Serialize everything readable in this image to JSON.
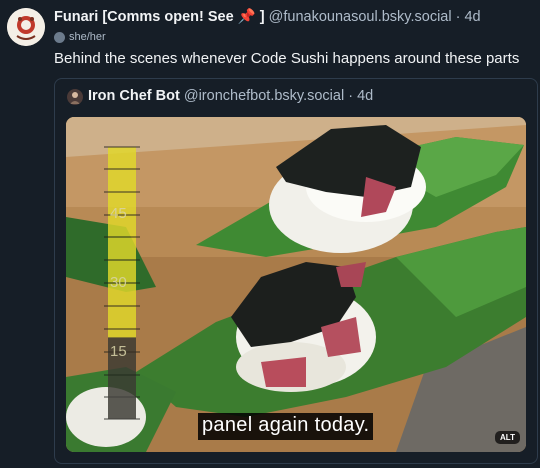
{
  "post": {
    "author": "Funari [Comms open! See ",
    "author_suffix": "]",
    "pin_icon": "pushpin-icon",
    "handle": "@funakounasoul.bsky.social",
    "separator": " · ",
    "time": "4d",
    "pronouns": "she/her",
    "text": "Behind the scenes whenever Code Sushi happens around these parts"
  },
  "quote": {
    "author": "Iron Chef Bot",
    "handle": "@ironchefbot.bsky.social",
    "separator": " · ",
    "time": "4d",
    "media": {
      "subtitle": "panel again today.",
      "alt_badge": "ALT",
      "gauge_labels": [
        "45",
        "30",
        "15"
      ],
      "gauge_level": 0.7
    }
  },
  "colors": {
    "background": "#161e27",
    "pin": "#e8457a",
    "handle": "#aebbc9",
    "gauge": "#e2d92a"
  }
}
